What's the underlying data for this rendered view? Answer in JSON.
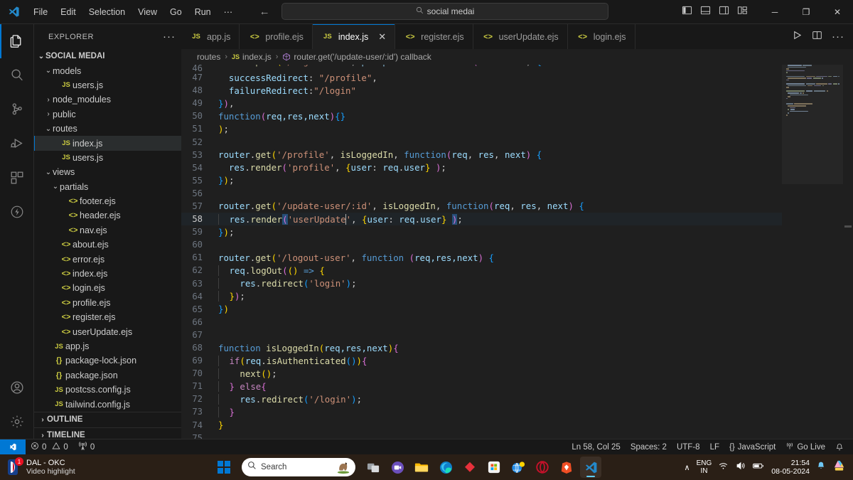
{
  "titlebar": {
    "menus": [
      "File",
      "Edit",
      "Selection",
      "View",
      "Go",
      "Run",
      "⋯"
    ],
    "back_label": "←",
    "forward_label": "→",
    "search_value": "social medai",
    "layout_icons": [
      "toggle-primary-sidebar",
      "toggle-panel",
      "toggle-secondary-sidebar",
      "customize-layout"
    ],
    "window_minimize": "─",
    "window_maximize": "❐",
    "window_close": "✕"
  },
  "activitybar": {
    "items": [
      {
        "name": "explorer",
        "active": true
      },
      {
        "name": "search",
        "active": false
      },
      {
        "name": "source-control",
        "active": false
      },
      {
        "name": "run-and-debug",
        "active": false
      },
      {
        "name": "extensions",
        "active": false
      },
      {
        "name": "thunder-client",
        "active": false
      }
    ],
    "bottom": [
      {
        "name": "accounts"
      },
      {
        "name": "manage-settings"
      }
    ]
  },
  "sidebar": {
    "header_title": "EXPLORER",
    "more_actions": "···",
    "root": "SOCIAL MEDAI",
    "tree": [
      {
        "label": "models",
        "type": "folder",
        "expanded": true,
        "indent": 1
      },
      {
        "label": "users.js",
        "type": "js",
        "indent": 2
      },
      {
        "label": "node_modules",
        "type": "folder",
        "expanded": false,
        "indent": 1
      },
      {
        "label": "public",
        "type": "folder",
        "expanded": false,
        "indent": 1
      },
      {
        "label": "routes",
        "type": "folder",
        "expanded": true,
        "indent": 1
      },
      {
        "label": "index.js",
        "type": "js",
        "indent": 2,
        "selected": true
      },
      {
        "label": "users.js",
        "type": "js",
        "indent": 2
      },
      {
        "label": "views",
        "type": "folder",
        "expanded": true,
        "indent": 1
      },
      {
        "label": "partials",
        "type": "folder",
        "expanded": true,
        "indent": 2
      },
      {
        "label": "footer.ejs",
        "type": "ejs",
        "indent": 3
      },
      {
        "label": "header.ejs",
        "type": "ejs",
        "indent": 3
      },
      {
        "label": "nav.ejs",
        "type": "ejs",
        "indent": 3
      },
      {
        "label": "about.ejs",
        "type": "ejs",
        "indent": 2
      },
      {
        "label": "error.ejs",
        "type": "ejs",
        "indent": 2
      },
      {
        "label": "index.ejs",
        "type": "ejs",
        "indent": 2
      },
      {
        "label": "login.ejs",
        "type": "ejs",
        "indent": 2
      },
      {
        "label": "profile.ejs",
        "type": "ejs",
        "indent": 2
      },
      {
        "label": "register.ejs",
        "type": "ejs",
        "indent": 2
      },
      {
        "label": "userUpdate.ejs",
        "type": "ejs",
        "indent": 2
      },
      {
        "label": "app.js",
        "type": "js",
        "indent": 1
      },
      {
        "label": "package-lock.json",
        "type": "json",
        "indent": 1
      },
      {
        "label": "package.json",
        "type": "json",
        "indent": 1
      },
      {
        "label": "postcss.config.js",
        "type": "js",
        "indent": 1
      },
      {
        "label": "tailwind.config.js",
        "type": "js",
        "indent": 1
      }
    ],
    "sections": [
      "OUTLINE",
      "TIMELINE"
    ]
  },
  "tabs": [
    {
      "label": "app.js",
      "type": "js",
      "active": false,
      "closable": false
    },
    {
      "label": "profile.ejs",
      "type": "ejs",
      "active": false,
      "closable": false
    },
    {
      "label": "index.js",
      "type": "js",
      "active": true,
      "closable": true
    },
    {
      "label": "register.ejs",
      "type": "ejs",
      "active": false,
      "closable": false
    },
    {
      "label": "userUpdate.ejs",
      "type": "ejs",
      "active": false,
      "closable": false
    },
    {
      "label": "login.ejs",
      "type": "ejs",
      "active": false,
      "closable": false
    }
  ],
  "editor_actions": [
    "run-code",
    "split-editor",
    "more-actions"
  ],
  "breadcrumb": {
    "folder": "routes",
    "file": "index.js",
    "symbol": "router.get('/update-user/:id') callback",
    "separator": "›"
  },
  "code": {
    "first_visible_line": 46,
    "lines": [
      {
        "n": 46,
        "clipped": true,
        "text": "router.post('/login-user', passport.authenticate( 'local' , {"
      },
      {
        "n": 47
      },
      {
        "n": 48
      },
      {
        "n": 49
      },
      {
        "n": 50
      },
      {
        "n": 51
      },
      {
        "n": 52
      },
      {
        "n": 53
      },
      {
        "n": 54
      },
      {
        "n": 55
      },
      {
        "n": 56
      },
      {
        "n": 57
      },
      {
        "n": 58,
        "current": true
      },
      {
        "n": 59
      },
      {
        "n": 60
      },
      {
        "n": 61
      },
      {
        "n": 62
      },
      {
        "n": 63
      },
      {
        "n": 64
      },
      {
        "n": 65
      },
      {
        "n": 66
      },
      {
        "n": 67
      },
      {
        "n": 68
      },
      {
        "n": 69
      },
      {
        "n": 70
      },
      {
        "n": 71
      },
      {
        "n": 72
      },
      {
        "n": 73
      },
      {
        "n": 74
      },
      {
        "n": 75
      }
    ],
    "text_lines": {
      "47": "  successRedirect: \"/profile\",",
      "48": "  failureRedirect:\"/login\"",
      "49": "}),",
      "50": "function(req,res,next){}",
      "51": ");",
      "52": "",
      "53": "router.get('/profile', isLoggedIn, function(req, res, next) {",
      "54": "  res.render('profile', {user: req.user} );",
      "55": "});",
      "56": "",
      "57": "router.get('/update-user/:id', isLoggedIn, function(req, res, next) {",
      "58": "  res.render('userUpdate', {user: req.user} );",
      "59": "});",
      "60": "",
      "61": "router.get('/logout-user', function (req,res,next) {",
      "62": "  req.logOut(() => {",
      "63": "    res.redirect('login');",
      "64": "  });",
      "65": "})",
      "66": "",
      "67": "",
      "68": "function isLoggedIn(req,res,next){",
      "69": "  if(req.isAuthenticated()){",
      "70": "    next();",
      "71": "  } else{",
      "72": "    res.redirect('/login');",
      "73": "  }",
      "74": "}",
      "75": ""
    }
  },
  "statusbar": {
    "remote_icon": "remote-window",
    "errors": "0",
    "warnings": "0",
    "ports": "0",
    "position": "Ln 58, Col 25",
    "spaces": "Spaces: 2",
    "encoding": "UTF-8",
    "eol": "LF",
    "language": "JavaScript",
    "language_icon": "{}",
    "go_live": "Go Live",
    "bell": "bell-icon"
  },
  "taskbar": {
    "widget_title": "DAL - OKC",
    "widget_subtitle": "Video highlight",
    "widget_badge": "1",
    "search_placeholder": "Search",
    "apps": [
      {
        "name": "start-button"
      },
      {
        "name": "task-view"
      },
      {
        "name": "teams-app"
      },
      {
        "name": "file-explorer"
      },
      {
        "name": "microsoft-edge"
      },
      {
        "name": "red-diamond-app"
      },
      {
        "name": "microsoft-store"
      },
      {
        "name": "globe-app"
      },
      {
        "name": "opera-browser"
      },
      {
        "name": "brave-browser"
      },
      {
        "name": "visual-studio-code",
        "active": true
      }
    ],
    "tray": {
      "chevron": "∧",
      "lang_line1": "ENG",
      "lang_line2": "IN",
      "time": "21:54",
      "date": "08-05-2024",
      "notification": "bell-icon",
      "copilot": "copilot-icon"
    }
  },
  "colors": {
    "accent": "#0078d4",
    "editor_bg": "#1f1f1f",
    "chrome_bg": "#181818",
    "taskbar_bg": "#2a1f16",
    "js_yellow": "#cbcb41"
  }
}
